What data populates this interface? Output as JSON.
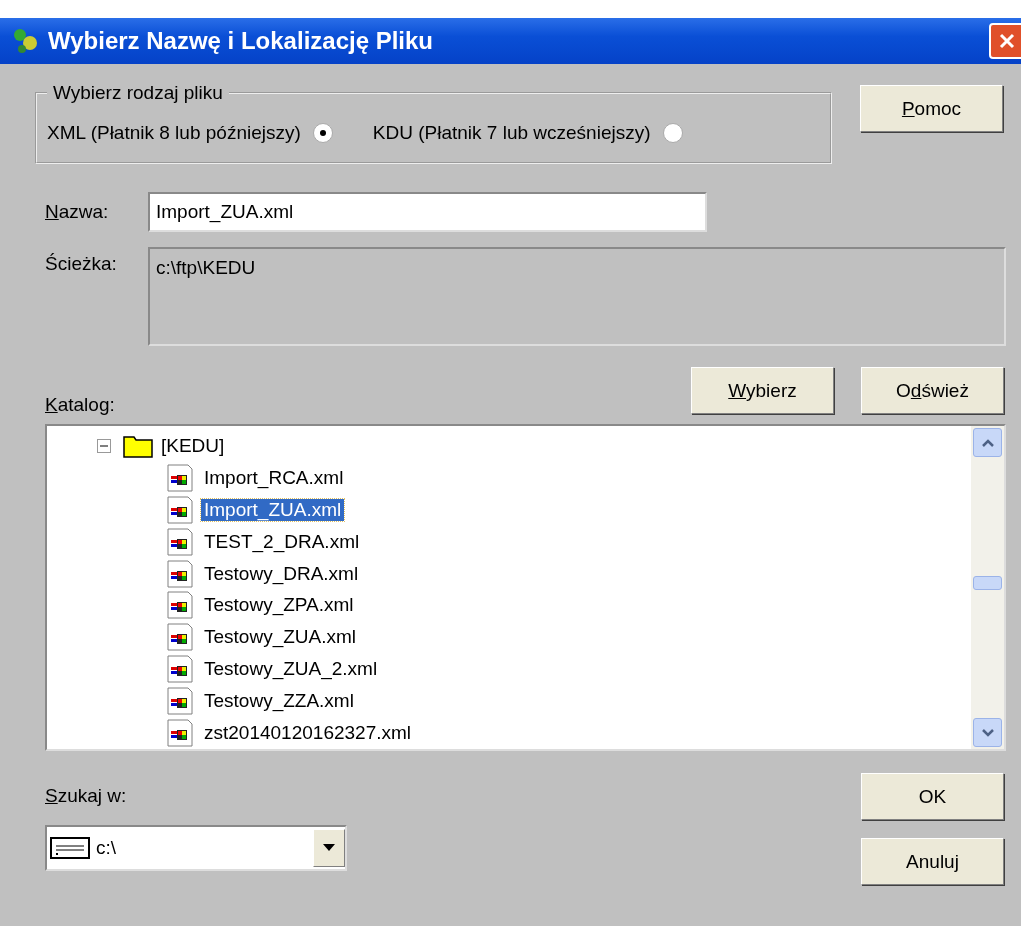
{
  "window": {
    "title": "Wybierz Nazwę i Lokalizację Pliku"
  },
  "file_type": {
    "legend": "Wybierz rodzaj pliku",
    "options": [
      {
        "label": "XML (Płatnik 8 lub późniejszy)",
        "selected": true
      },
      {
        "label": "KDU (Płatnik 7 lub wcześniejszy)",
        "selected": false
      }
    ]
  },
  "help_button": {
    "label": {
      "key": "P",
      "after": "omoc"
    }
  },
  "name": {
    "label": {
      "key": "N",
      "after": "azwa:"
    },
    "value": "Import_ZUA.xml"
  },
  "path": {
    "label": "Ścieżka:",
    "value": "c:\\ftp\\KEDU"
  },
  "catalog": {
    "label": {
      "key": "K",
      "after": "atalog:"
    }
  },
  "select_button": {
    "label": {
      "key": "W",
      "after": "ybierz"
    }
  },
  "refresh_button": {
    "label": {
      "before": "O",
      "key": "d",
      "after": "śwież"
    }
  },
  "tree": {
    "label": "[KEDU]",
    "expanded": true,
    "children": [
      {
        "label": "Import_RCA.xml",
        "selected": false
      },
      {
        "label": "Import_ZUA.xml",
        "selected": true
      },
      {
        "label": "TEST_2_DRA.xml",
        "selected": false
      },
      {
        "label": "Testowy_DRA.xml",
        "selected": false
      },
      {
        "label": "Testowy_ZPA.xml",
        "selected": false
      },
      {
        "label": "Testowy_ZUA.xml",
        "selected": false
      },
      {
        "label": "Testowy_ZUA_2.xml",
        "selected": false
      },
      {
        "label": "Testowy_ZZA.xml",
        "selected": false
      },
      {
        "label": "zst20140120162327.xml",
        "selected": false
      }
    ]
  },
  "search_in": {
    "label": {
      "key": "S",
      "after": "zukaj w:"
    },
    "value": "c:\\"
  },
  "ok_button": {
    "label": "OK"
  },
  "cancel_button": {
    "label": "Anuluj"
  }
}
